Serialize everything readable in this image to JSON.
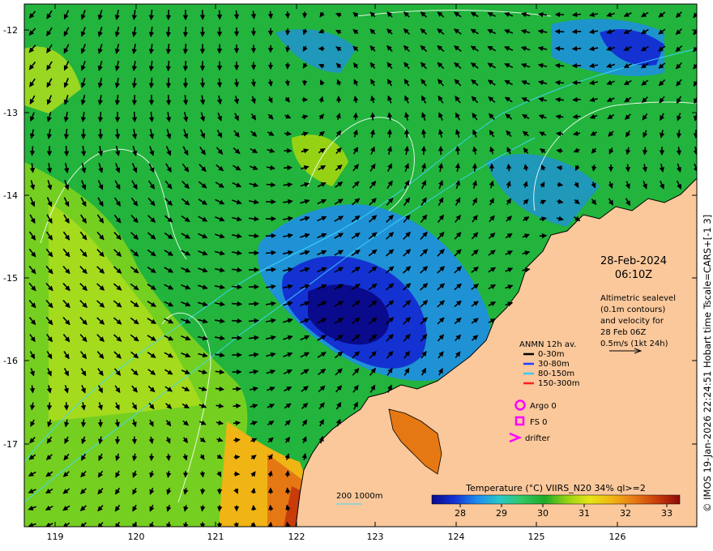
{
  "map": {
    "lon_ticks": [
      "119",
      "120",
      "121",
      "122",
      "123",
      "124",
      "125",
      "126"
    ],
    "lat_ticks": [
      "-12",
      "-13",
      "-14",
      "-15",
      "-16",
      "-17"
    ]
  },
  "date": {
    "line1": "28-Feb-2024",
    "line2": "06:10Z"
  },
  "altimetry": {
    "lines": [
      "Altimetric sealevel",
      "(0.1m contours)",
      "and velocity for",
      "28 Feb 06Z",
      "0.5m/s (1kt 24h)"
    ]
  },
  "anmn": {
    "title": "ANMN 12h av.",
    "items": [
      {
        "label": "0-30m",
        "color": "#000000"
      },
      {
        "label": "30-80m",
        "color": "#1f3fff"
      },
      {
        "label": "80-150m",
        "color": "#3fc8ff"
      },
      {
        "label": "150-300m",
        "color": "#ff2020"
      }
    ]
  },
  "platforms": {
    "argo": "Argo 0",
    "fs": "FS 0",
    "drifter": "drifter",
    "color": "#ff00ff"
  },
  "isobath": {
    "label": "200  1000m",
    "color": "#40d8ff"
  },
  "colorbar": {
    "title": "Temperature (°C) VIIRS_N20 34% ql>=2",
    "ticks": [
      "28",
      "29",
      "30",
      "31",
      "32",
      "33"
    ],
    "colors": [
      "#0a0a8c",
      "#1432d2",
      "#1e8cf0",
      "#28c8c8",
      "#32c864",
      "#1eaa28",
      "#96d214",
      "#e6e614",
      "#f0b414",
      "#e67814",
      "#c83c0a",
      "#8c0a0a"
    ]
  },
  "credit": "© IMOS 19-Jan-2026 22:24:51 Hobart time Tscale=CARS+[-1 3]"
}
